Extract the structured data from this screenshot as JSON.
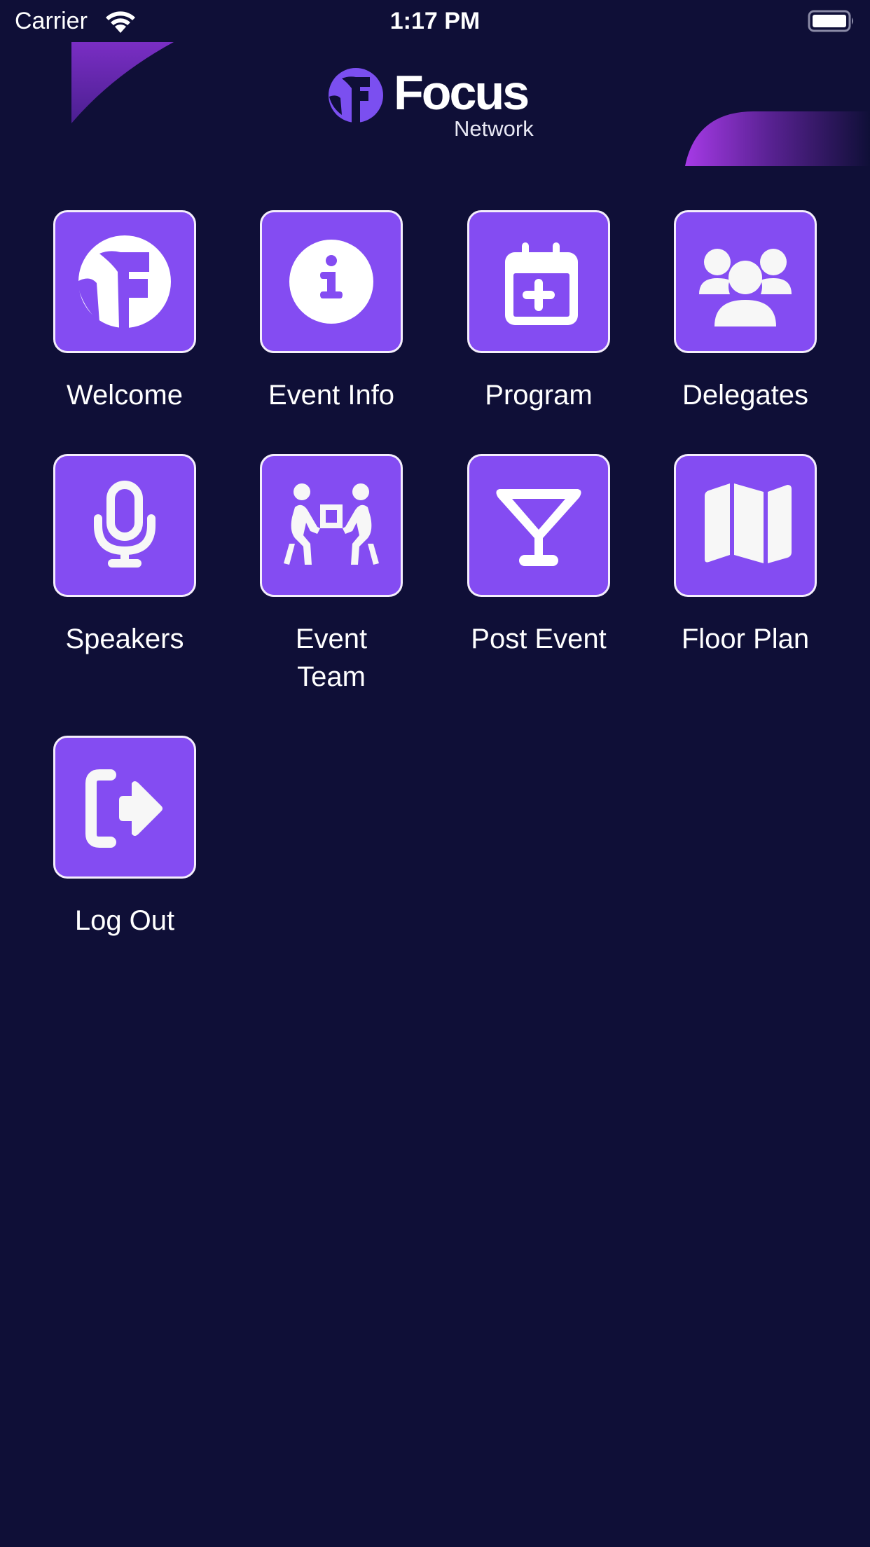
{
  "status_bar": {
    "carrier": "Carrier",
    "time": "1:17 PM",
    "wifi_icon": "wifi-icon",
    "battery_icon": "battery-full-icon"
  },
  "header": {
    "logo_title": "Focus",
    "logo_subtitle": "Network",
    "logo_icon": "focus-network-logo-icon"
  },
  "colors": {
    "background": "#0f0f37",
    "tile_fill": "#844cf2",
    "tile_border": "#f4eefc",
    "accent_gradient_start": "#a63ae6",
    "icon_color": "#ffffff"
  },
  "menu": {
    "items": [
      {
        "label": "Welcome",
        "icon": "focus-logo-icon"
      },
      {
        "label": "Event Info",
        "icon": "info-circle-icon"
      },
      {
        "label": "Program",
        "icon": "calendar-plus-icon"
      },
      {
        "label": "Delegates",
        "icon": "people-group-icon"
      },
      {
        "label": "Speakers",
        "icon": "microphone-icon"
      },
      {
        "label": "Event\nTeam",
        "icon": "people-carrying-box-icon"
      },
      {
        "label": "Post Event",
        "icon": "cocktail-glass-icon"
      },
      {
        "label": "Floor Plan",
        "icon": "folded-map-icon"
      },
      {
        "label": "Log Out",
        "icon": "logout-arrow-icon"
      }
    ]
  }
}
